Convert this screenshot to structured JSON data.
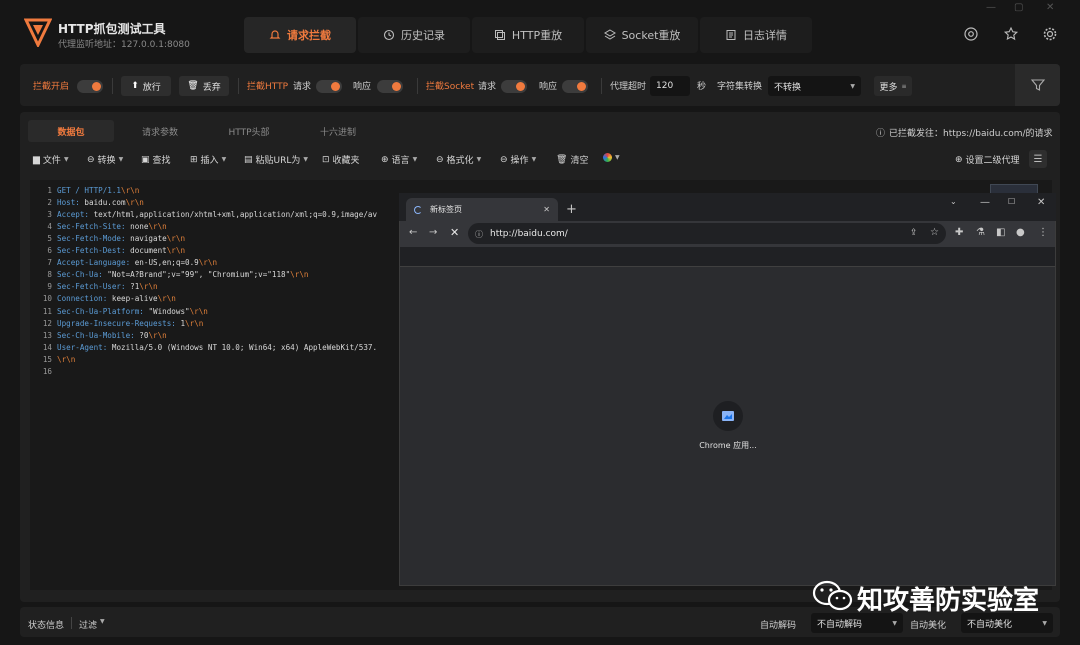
{
  "app": {
    "title": "HTTP抓包测试工具",
    "proxy_label": "代理监听地址：127.0.0.1:8080"
  },
  "main_tabs": [
    {
      "label": "请求拦截",
      "icon": "bell-icon",
      "active": true
    },
    {
      "label": "历史记录",
      "icon": "history-icon",
      "active": false
    },
    {
      "label": "HTTP重放",
      "icon": "copy-icon",
      "active": false
    },
    {
      "label": "Socket重放",
      "icon": "layers-icon",
      "active": false
    },
    {
      "label": "日志详情",
      "icon": "document-icon",
      "active": false
    }
  ],
  "toolbar": {
    "intercept_on": "拦截开启",
    "release": "放行",
    "discard": "丢弃",
    "intercept_http": "拦截HTTP",
    "request": "请求",
    "response": "响应",
    "intercept_socket": "拦截Socket",
    "request2": "请求",
    "response2": "响应",
    "proxy_timeout": "代理超时",
    "timeout_value": "120",
    "seconds": "秒",
    "charset_label": "字符集转换",
    "charset_value": "不转换",
    "more": "更多"
  },
  "sub_tabs": [
    "数据包",
    "请求参数",
    "HTTP头部",
    "十六进制"
  ],
  "intercepted_notice": "已拦截发往：https://baidu.com/的请求",
  "editor_menu": [
    {
      "label": "文件",
      "icon": "folder-icon"
    },
    {
      "label": "转换",
      "icon": "convert-icon"
    },
    {
      "label": "查找",
      "icon": "find-icon"
    },
    {
      "label": "插入",
      "icon": "plus-icon"
    },
    {
      "label": "粘贴URL为",
      "icon": "paste-icon"
    },
    {
      "label": "收藏夹",
      "icon": "bookmark-icon"
    },
    {
      "label": "语言",
      "icon": "globe-icon"
    },
    {
      "label": "格式化",
      "icon": "format-icon"
    },
    {
      "label": "操作",
      "icon": "action-icon"
    },
    {
      "label": "清空",
      "icon": "trash-icon"
    }
  ],
  "second_proxy": "设置二级代理",
  "code_lines": [
    {
      "n": "1",
      "key": "GET / HTTP/1.1",
      "val": "",
      "crlf": "\\r\\n"
    },
    {
      "n": "2",
      "key": "Host:",
      "val": " baidu.com",
      "crlf": "\\r\\n"
    },
    {
      "n": "3",
      "key": "Accept:",
      "val": " text/html,application/xhtml+xml,application/xml;q=0.9,image/av",
      "crlf": ""
    },
    {
      "n": "4",
      "key": "Sec-Fetch-Site:",
      "val": " none",
      "crlf": "\\r\\n"
    },
    {
      "n": "5",
      "key": "Sec-Fetch-Mode:",
      "val": " navigate",
      "crlf": "\\r\\n"
    },
    {
      "n": "6",
      "key": "Sec-Fetch-Dest:",
      "val": " document",
      "crlf": "\\r\\n"
    },
    {
      "n": "7",
      "key": "Accept-Language:",
      "val": " en-US,en;q=0.9",
      "crlf": "\\r\\n"
    },
    {
      "n": "8",
      "key": "Sec-Ch-Ua:",
      "val": " \"Not=A?Brand\";v=\"99\", \"Chromium\";v=\"118\"",
      "crlf": "\\r\\n"
    },
    {
      "n": "9",
      "key": "Sec-Fetch-User:",
      "val": " ?1",
      "crlf": "\\r\\n"
    },
    {
      "n": "10",
      "key": "Connection:",
      "val": " keep-alive",
      "crlf": "\\r\\n"
    },
    {
      "n": "11",
      "key": "Sec-Ch-Ua-Platform:",
      "val": " \"Windows\"",
      "crlf": "\\r\\n"
    },
    {
      "n": "12",
      "key": "Upgrade-Insecure-Requests:",
      "val": " 1",
      "crlf": "\\r\\n"
    },
    {
      "n": "13",
      "key": "Sec-Ch-Ua-Mobile:",
      "val": " ?0",
      "crlf": "\\r\\n"
    },
    {
      "n": "14",
      "key": "User-Agent:",
      "val": " Mozilla/5.0 (Windows NT 10.0; Win64; x64) AppleWebKit/537.",
      "crlf": ""
    },
    {
      "n": "15",
      "key": "",
      "val": "",
      "crlf": "\\r\\n"
    },
    {
      "n": "16",
      "key": "",
      "val": "",
      "crlf": ""
    }
  ],
  "chrome": {
    "tab_title": "新标签页",
    "url": "http://baidu.com/",
    "app_label": "Chrome 应用..."
  },
  "status": {
    "info": "状态信息",
    "filter": "过滤",
    "auto_decode_label": "自动解码",
    "auto_decode_value": "不自动解码",
    "auto_beautify_label": "自动美化",
    "auto_beautify_value": "不自动美化"
  },
  "watermark": "知攻善防实验室",
  "colors": {
    "accent": "#f07a3e",
    "key": "#5b9bd5",
    "bg": "#161616"
  }
}
